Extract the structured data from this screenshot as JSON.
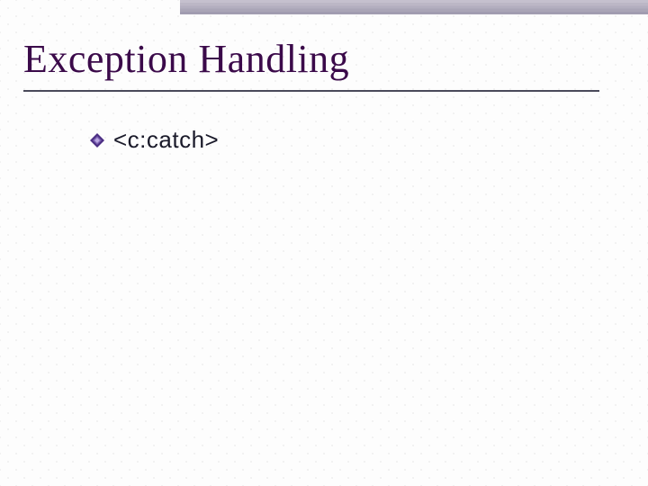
{
  "slide": {
    "title": "Exception Handling",
    "bullets": [
      {
        "text": "<c:catch>"
      }
    ]
  },
  "colors": {
    "title": "#3b0a4a",
    "bullet_fill": "#5a3a8a",
    "underline": "#4a4a5a"
  }
}
